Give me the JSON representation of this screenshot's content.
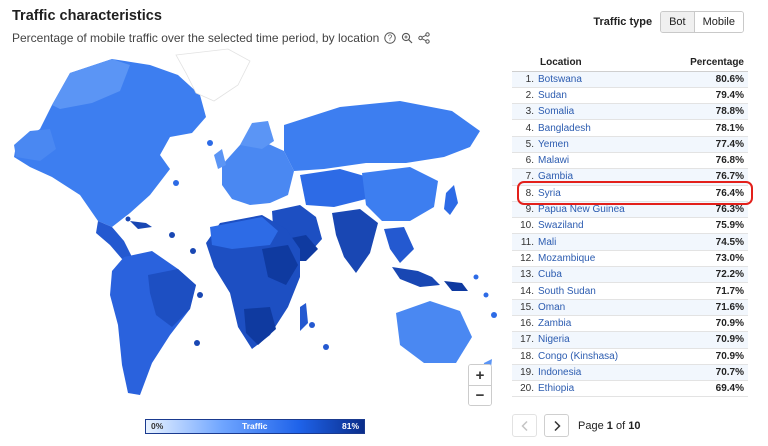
{
  "header": {
    "title": "Traffic characteristics",
    "subtitle": "Percentage of mobile traffic over the selected time period, by location"
  },
  "traffic_type": {
    "label": "Traffic type",
    "options": [
      "Bot",
      "Mobile"
    ],
    "selected": "Mobile"
  },
  "zoom": {
    "in_label": "+",
    "out_label": "−"
  },
  "legend": {
    "min_label": "0%",
    "title": "Traffic",
    "max_label": "81%"
  },
  "table": {
    "headers": {
      "location": "Location",
      "percentage": "Percentage"
    },
    "rows": [
      {
        "rank": "1.",
        "location": "Botswana",
        "percentage": "80.6%"
      },
      {
        "rank": "2.",
        "location": "Sudan",
        "percentage": "79.4%"
      },
      {
        "rank": "3.",
        "location": "Somalia",
        "percentage": "78.8%"
      },
      {
        "rank": "4.",
        "location": "Bangladesh",
        "percentage": "78.1%"
      },
      {
        "rank": "5.",
        "location": "Yemen",
        "percentage": "77.4%"
      },
      {
        "rank": "6.",
        "location": "Malawi",
        "percentage": "76.8%"
      },
      {
        "rank": "7.",
        "location": "Gambia",
        "percentage": "76.7%"
      },
      {
        "rank": "8.",
        "location": "Syria",
        "percentage": "76.4%"
      },
      {
        "rank": "9.",
        "location": "Papua New Guinea",
        "percentage": "76.3%"
      },
      {
        "rank": "10.",
        "location": "Swaziland",
        "percentage": "75.9%"
      },
      {
        "rank": "11.",
        "location": "Mali",
        "percentage": "74.5%"
      },
      {
        "rank": "12.",
        "location": "Mozambique",
        "percentage": "73.0%"
      },
      {
        "rank": "13.",
        "location": "Cuba",
        "percentage": "72.2%"
      },
      {
        "rank": "14.",
        "location": "South Sudan",
        "percentage": "71.7%"
      },
      {
        "rank": "15.",
        "location": "Oman",
        "percentage": "71.6%"
      },
      {
        "rank": "16.",
        "location": "Zambia",
        "percentage": "70.9%"
      },
      {
        "rank": "17.",
        "location": "Nigeria",
        "percentage": "70.9%"
      },
      {
        "rank": "18.",
        "location": "Congo (Kinshasa)",
        "percentage": "70.9%"
      },
      {
        "rank": "19.",
        "location": "Indonesia",
        "percentage": "70.7%"
      },
      {
        "rank": "20.",
        "location": "Ethiopia",
        "percentage": "69.4%"
      }
    ],
    "highlighted_location": "Syria"
  },
  "pagination": {
    "prefix": "Page",
    "current": "1",
    "separator": "of",
    "total": "10"
  },
  "colors": {
    "map_light": "#5b95f5",
    "map_mid": "#2d6be6",
    "map_dark": "#1947b3",
    "highlight_border": "#e3201b",
    "link": "#2c5cb0"
  }
}
